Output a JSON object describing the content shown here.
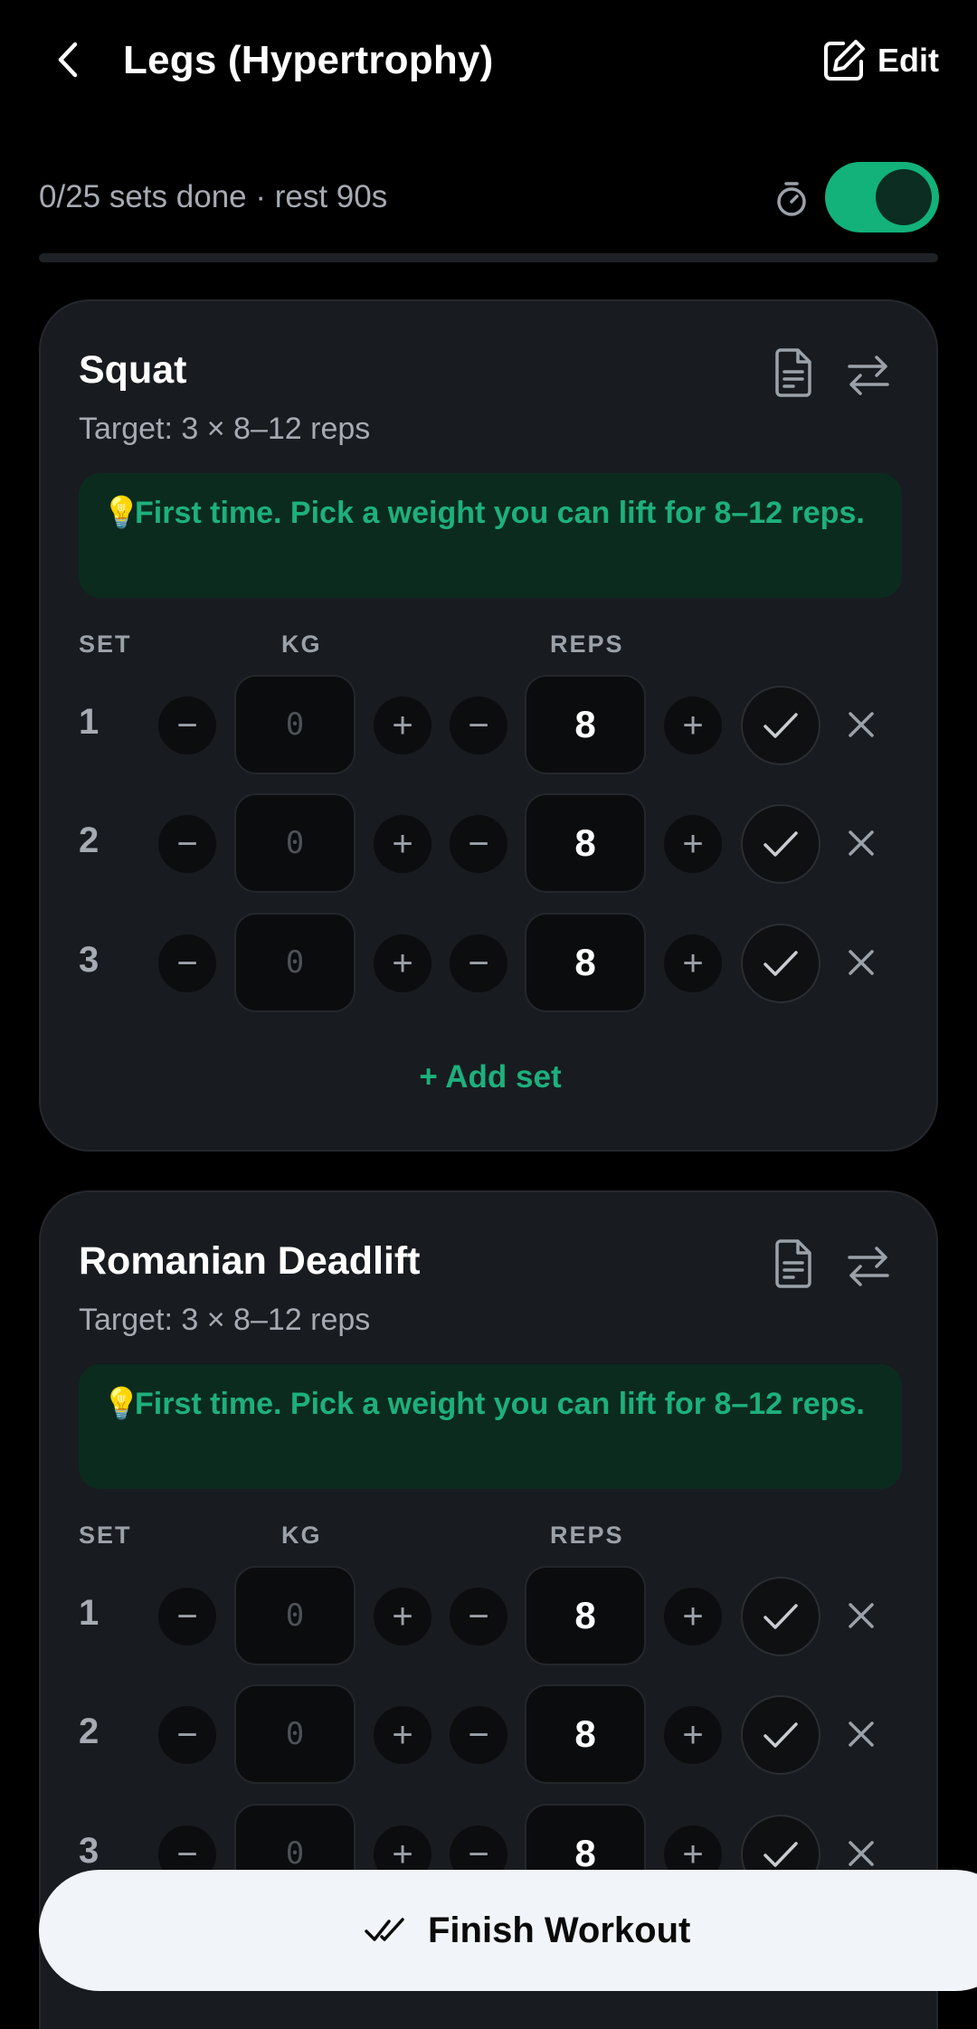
{
  "header": {
    "title": "Legs (Hypertrophy)",
    "edit_label": "Edit"
  },
  "status": {
    "text": "0/25 sets done · rest 90s",
    "progress_fraction": 0,
    "rest_timer_enabled": true
  },
  "colors": {
    "accent": "#12b27a",
    "tip_text": "#1db07d",
    "tip_bg": "#0b2b1f",
    "card_bg": "#181b1f"
  },
  "columns": {
    "set": "SET",
    "kg": "KG",
    "reps": "REPS"
  },
  "exercises": [
    {
      "name": "Squat",
      "target": "Target: 3 × 8–12 reps",
      "tip_icon": "💡",
      "tip": "First time. Pick a weight you can lift for 8–12 reps.",
      "sets": [
        {
          "num": "1",
          "kg": "0",
          "reps": "8"
        },
        {
          "num": "2",
          "kg": "0",
          "reps": "8"
        },
        {
          "num": "3",
          "kg": "0",
          "reps": "8"
        }
      ],
      "add_set_label": "+ Add set"
    },
    {
      "name": "Romanian Deadlift",
      "target": "Target: 3 × 8–12 reps",
      "tip_icon": "💡",
      "tip": "First time. Pick a weight you can lift for 8–12 reps.",
      "sets": [
        {
          "num": "1",
          "kg": "0",
          "reps": "8"
        },
        {
          "num": "2",
          "kg": "0",
          "reps": "8"
        },
        {
          "num": "3",
          "kg": "0",
          "reps": "8"
        }
      ]
    }
  ],
  "finish": {
    "label": "Finish Workout"
  },
  "icons": {
    "back": "chevron-left-icon",
    "edit": "edit-icon",
    "timer": "timer-icon",
    "notes": "notes-icon",
    "swap": "swap-icon",
    "minus": "−",
    "plus": "+",
    "check": "check-icon",
    "delete": "close-icon",
    "finish": "double-check-icon"
  }
}
